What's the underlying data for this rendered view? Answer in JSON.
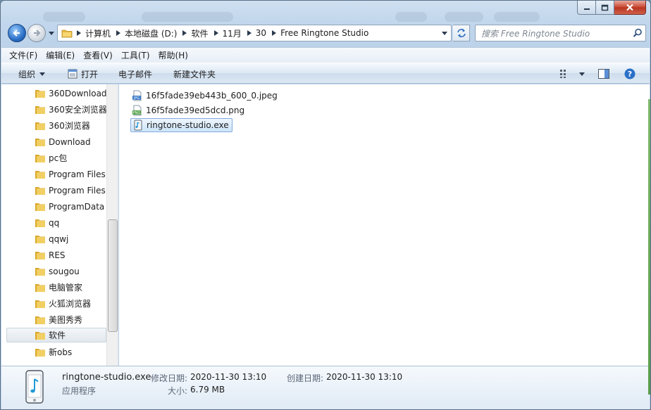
{
  "window": {
    "controls": {
      "minimize": "minimize",
      "maximize": "maximize",
      "close": "close"
    }
  },
  "address_bar": {
    "crumbs": [
      "计算机",
      "本地磁盘 (D:)",
      "软件",
      "11月",
      "30",
      "Free Ringtone Studio"
    ]
  },
  "search": {
    "placeholder": "搜索 Free Ringtone Studio"
  },
  "menubar": {
    "items": [
      "文件(F)",
      "编辑(E)",
      "查看(V)",
      "工具(T)",
      "帮助(H)"
    ]
  },
  "commandbar": {
    "organize": "组织",
    "open": "打开",
    "email": "电子邮件",
    "new_folder": "新建文件夹"
  },
  "nav_tree": {
    "items": [
      "360Download",
      "360安全浏览器",
      "360浏览器",
      "Download",
      "pc包",
      "Program Files",
      "Program Files",
      "ProgramData",
      "qq",
      "qqwj",
      "RES",
      "sougou",
      "电脑管家",
      "火狐浏览器",
      "美图秀秀",
      "软件",
      "新obs"
    ],
    "selected": "软件"
  },
  "files": [
    {
      "name": "16f5fade39eb443b_600_0.jpeg",
      "icon": "jpeg-file-icon"
    },
    {
      "name": "16f5fade39ed5dcd.png",
      "icon": "png-file-icon"
    },
    {
      "name": "ringtone-studio.exe",
      "icon": "exe-file-icon",
      "selected": true
    }
  ],
  "details": {
    "file_name": "ringtone-studio.exe",
    "file_type": "应用程序",
    "modified_label": "修改日期:",
    "modified_value": "2020-11-30 13:10",
    "created_label": "创建日期:",
    "created_value": "2020-11-30 13:10",
    "size_label": "大小:",
    "size_value": "6.79 MB"
  },
  "colors": {
    "accent": "#2a6fc7",
    "selection": "#cce4f8",
    "close_button": "#c8452f",
    "folder": "#e8b93c"
  }
}
